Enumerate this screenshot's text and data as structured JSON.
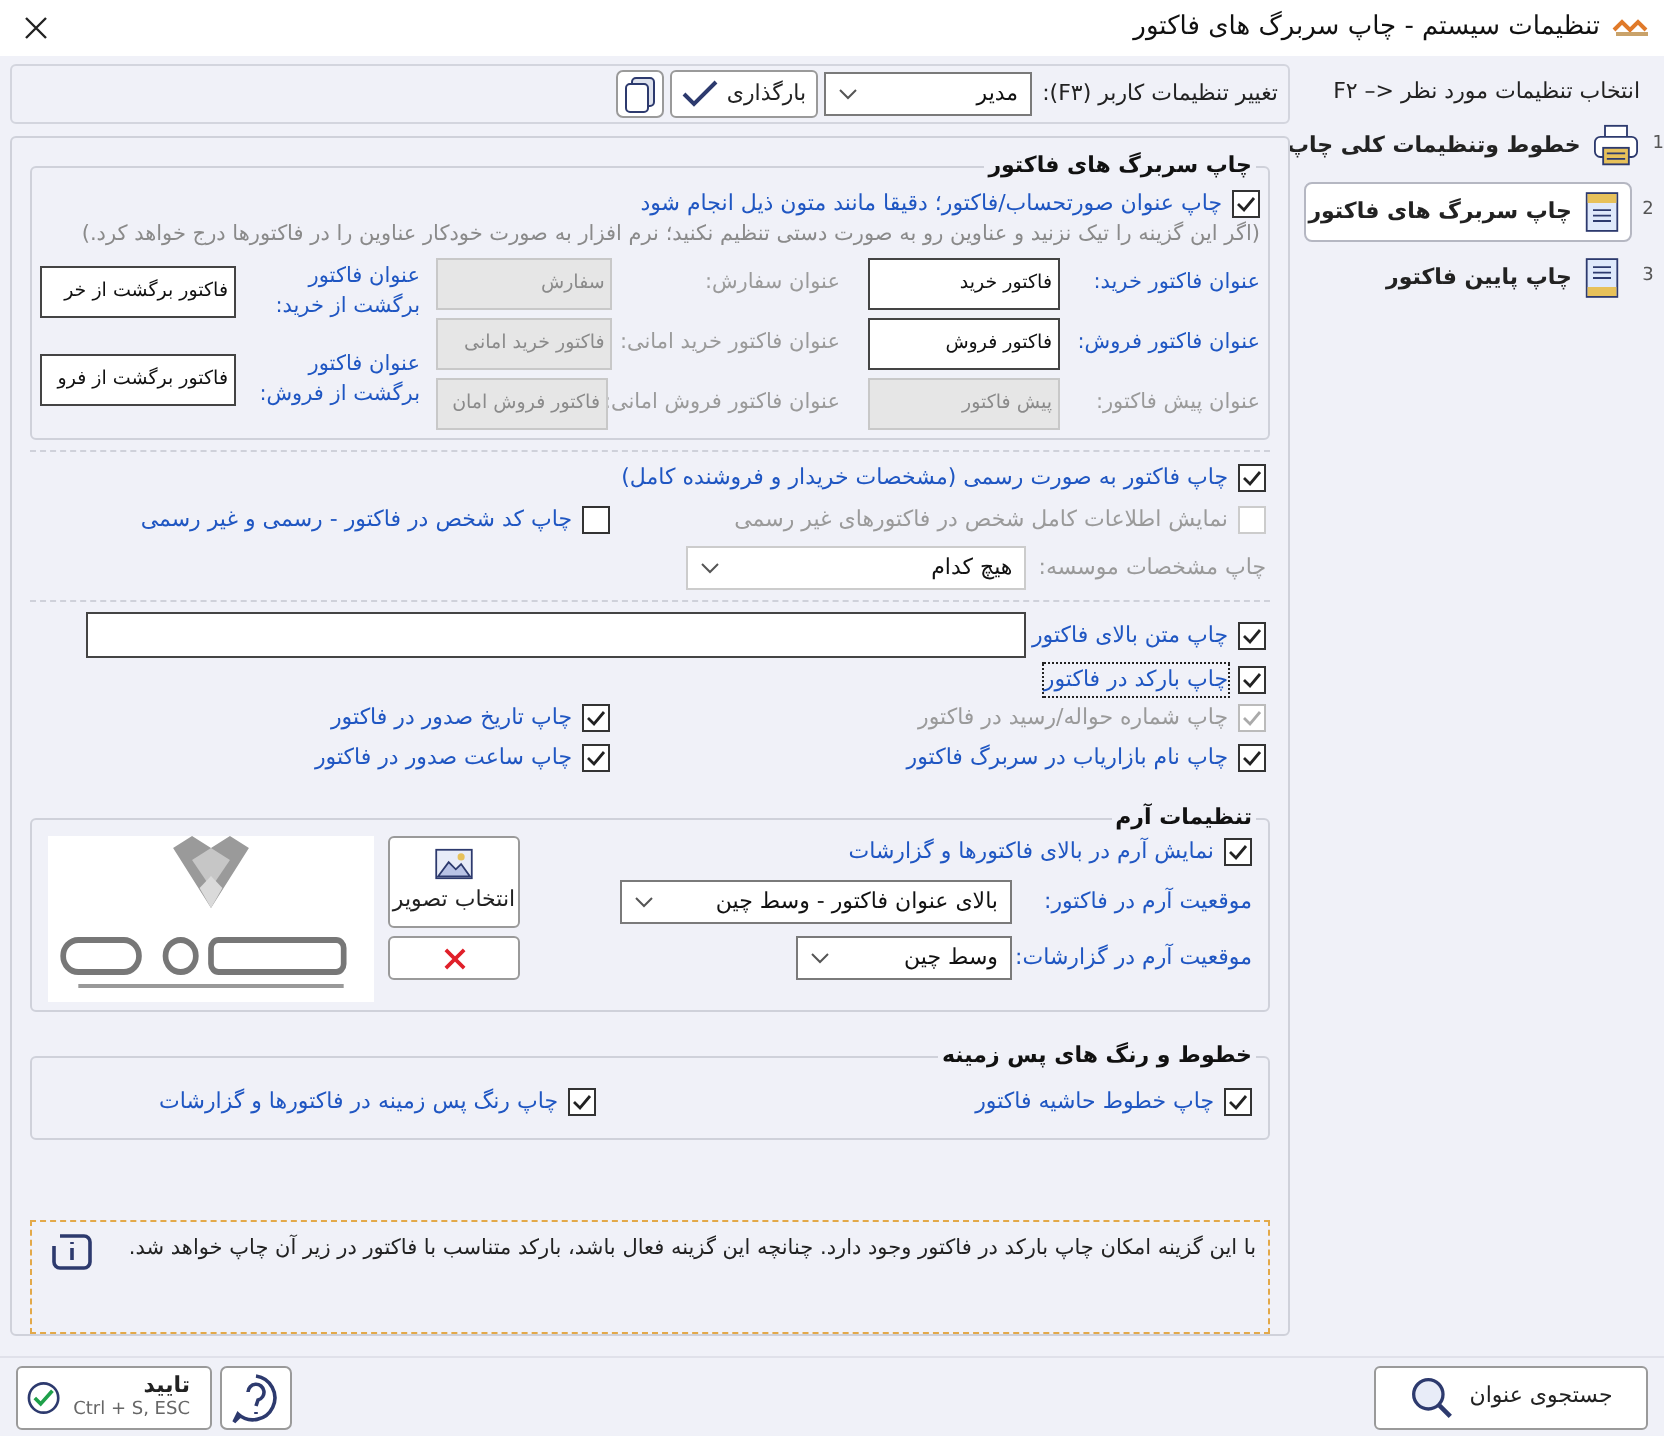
{
  "window": {
    "title": "تنظیمات سیستم - چاپ سربرگ های فاکتور"
  },
  "toolbar": {
    "user_label": "تغییر تنظیمات کاربر (F۳):",
    "user_value": "مدیر",
    "load_button": "بارگذاری"
  },
  "sidebar": {
    "hint": "F۲ –> انتخاب تنظیمات مورد نظر",
    "items": [
      {
        "number": "1",
        "label": "خطوط وتنظیمات کلی چاپ",
        "kind": "printer",
        "selected": false
      },
      {
        "number": "2",
        "label": "چاپ سربرگ های فاکتور",
        "kind": "header",
        "selected": true
      },
      {
        "number": "3",
        "label": "چاپ پایین فاکتور",
        "kind": "footer",
        "selected": false
      }
    ]
  },
  "header_group": {
    "title": "چاپ سربرگ های فاکتور",
    "print_titles": {
      "label": "چاپ عنوان صورتحساب/فاکتور؛ دقیقا مانند متون ذیل انجام شود",
      "checked": true
    },
    "note": "(اگر این گزینه را تیک نزنید و عناوین رو به صورت دستی تنظیم نکنید؛ نرم افزار به صورت خودکار عناوین را در فاکتورها درج خواهد کرد.)",
    "fields": [
      {
        "label": "عنوان فاکتور خرید:",
        "value": "فاکتور خرید",
        "disabled": false
      },
      {
        "label": "عنوان سفارش:",
        "value": "سفارش",
        "disabled": true
      },
      {
        "label": "عنوان فاکتور فروش:",
        "value": "فاکتور فروش",
        "disabled": false
      },
      {
        "label": "عنوان فاکتور خرید امانی:",
        "value": "فاکتور خرید امانی",
        "disabled": true
      },
      {
        "label": "عنوان پیش فاکتور:",
        "value": "پیش فاکتور",
        "disabled": true
      },
      {
        "label": "عنوان فاکتور فروش امانی:",
        "value": "فاکتور فروش امان",
        "disabled": true
      }
    ],
    "return_fields": [
      {
        "label": "عنوان فاکتور برگشت از خرید:",
        "value": "فاکتور برگشت از خر"
      },
      {
        "label": "عنوان فاکتور برگشت از فروش:",
        "value": "فاکتور برگشت از فرو"
      }
    ]
  },
  "formal_section": {
    "formal": {
      "label": "چاپ فاکتور به صورت رسمی (مشخصات خریدار و فروشنده کامل)",
      "checked": true,
      "disabled": false
    },
    "full_info": {
      "label": "نمایش اطلاعات کامل شخص در فاکتورهای غیر رسمی",
      "checked": false,
      "disabled": true
    },
    "person_code": {
      "label": "چاپ کد شخص در فاکتور - رسمی و غیر رسمی",
      "checked": false,
      "disabled": false
    },
    "company_label": "چاپ مشخصات موسسه:",
    "company_value": "هیچ کدام"
  },
  "print_options": {
    "top_text": {
      "label": "چاپ متن بالای فاکتور",
      "checked": true,
      "disabled": false
    },
    "barcode": {
      "label": "چاپ بارکد در فاکتور",
      "checked": true,
      "disabled": false,
      "focused": true
    },
    "options": [
      {
        "label": "چاپ شماره حواله/رسید در فاکتور",
        "checked": true,
        "disabled": true
      },
      {
        "label": "چاپ تاریخ صدور در فاکتور",
        "checked": true,
        "disabled": false
      },
      {
        "label": "چاپ نام بازاریاب در سربرگ فاکتور",
        "checked": true,
        "disabled": false
      },
      {
        "label": "چاپ ساعت صدور در فاکتور",
        "checked": true,
        "disabled": false
      }
    ]
  },
  "logo_group": {
    "title": "تنظیمات آرم",
    "show_logo": {
      "label": "نمایش آرم در بالای فاکتورها و گزارشات",
      "checked": true,
      "disabled": false
    },
    "invoice_position_label": "موقعیت آرم در فاکتور:",
    "invoice_position": "بالای عنوان فاکتور - وسط چین",
    "report_position_label": "موقعیت آرم در گزارشات:",
    "report_position": "وسط چین",
    "choose_image_button": "انتخاب تصویر"
  },
  "lines_group": {
    "title": "خطوط و رنگ های پس زمینه",
    "options": [
      {
        "label": "چاپ خطوط حاشیه فاکتور",
        "checked": true,
        "disabled": false
      },
      {
        "label": "چاپ رنگ پس زمینه در فاکتورها و گزارشات",
        "checked": true,
        "disabled": false
      }
    ]
  },
  "info_note": "با این گزینه امکان چاپ بارکد در فاکتور وجود دارد. چنانچه این گزینه فعال باشد، بارکد متناسب با فاکتور در زیر آن چاپ خواهد شد.",
  "footer": {
    "confirm": "تایید",
    "confirm_shortcut": "Ctrl + S, ESC",
    "search": "جستجوی عنوان"
  }
}
